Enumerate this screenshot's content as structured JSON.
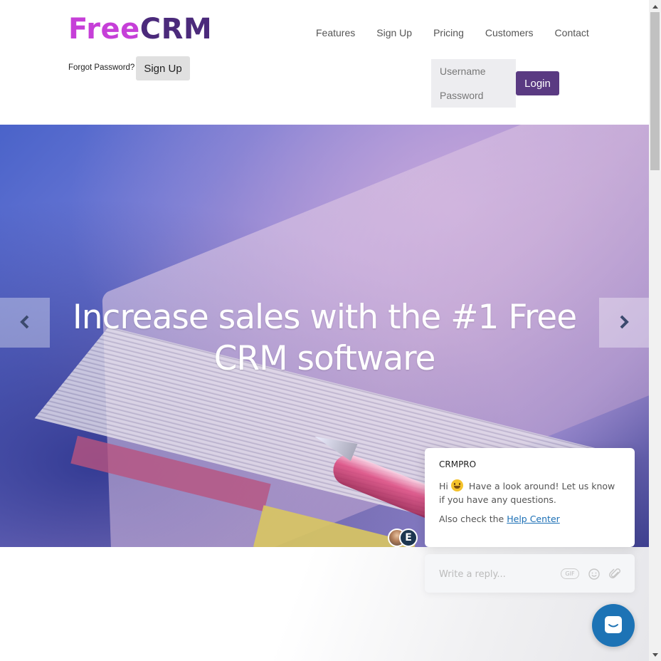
{
  "header": {
    "logo": {
      "part1": "Free",
      "part2": "CRM"
    },
    "nav": [
      "Features",
      "Sign Up",
      "Pricing",
      "Customers",
      "Contact"
    ],
    "forgot_password": "Forgot Password?",
    "signup_button": "Sign Up",
    "username_placeholder": "Username",
    "password_placeholder": "Password",
    "login_button": "Login"
  },
  "hero": {
    "title": "Increase sales with the #1 Free CRM software",
    "prev_icon": "chevron-left-icon",
    "next_icon": "chevron-right-icon"
  },
  "chat": {
    "sender": "CRMPRO",
    "message_greeting": "Hi",
    "message_body": "Have a look around! Let us know if you have any questions.",
    "also_text": "Also check the",
    "help_link": "Help Center",
    "avatar_initial": "E",
    "reply_placeholder": "Write a reply...",
    "gif_label": "GIF"
  },
  "colors": {
    "logo_free": "#c63fd8",
    "logo_crm": "#4b2a7b",
    "login_button": "#5a3a82",
    "launcher": "#1d73b5",
    "link": "#1b6fb5"
  }
}
